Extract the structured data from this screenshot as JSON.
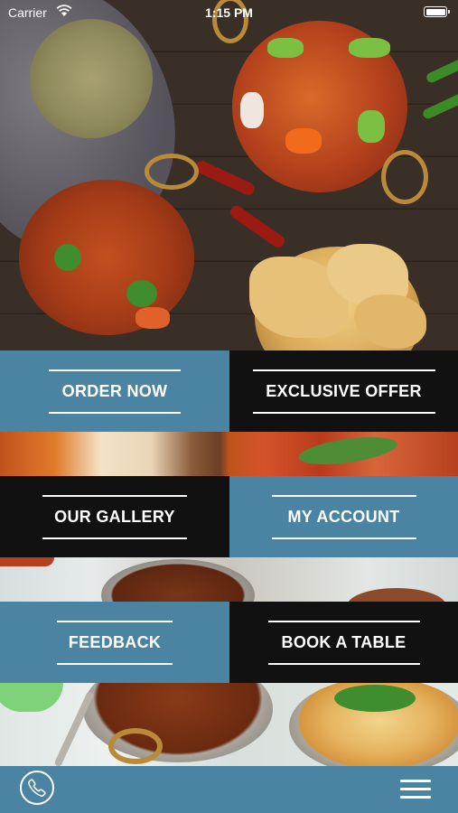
{
  "status_bar": {
    "carrier": "Carrier",
    "time": "1:15 PM",
    "wifi_icon": "wifi-icon",
    "battery_icon": "battery-icon"
  },
  "menu": {
    "order_now": "ORDER NOW",
    "exclusive_offer": "EXCLUSIVE OFFER",
    "our_gallery": "OUR GALLERY",
    "my_account": "MY ACCOUNT",
    "feedback": "FEEDBACK",
    "book_a_table": "BOOK A TABLE"
  },
  "bottom_bar": {
    "phone_icon": "phone-icon",
    "menu_icon": "hamburger-menu-icon"
  },
  "colors": {
    "tile_blue": "#4b84a3",
    "tile_black": "#111111",
    "text": "#ffffff"
  }
}
